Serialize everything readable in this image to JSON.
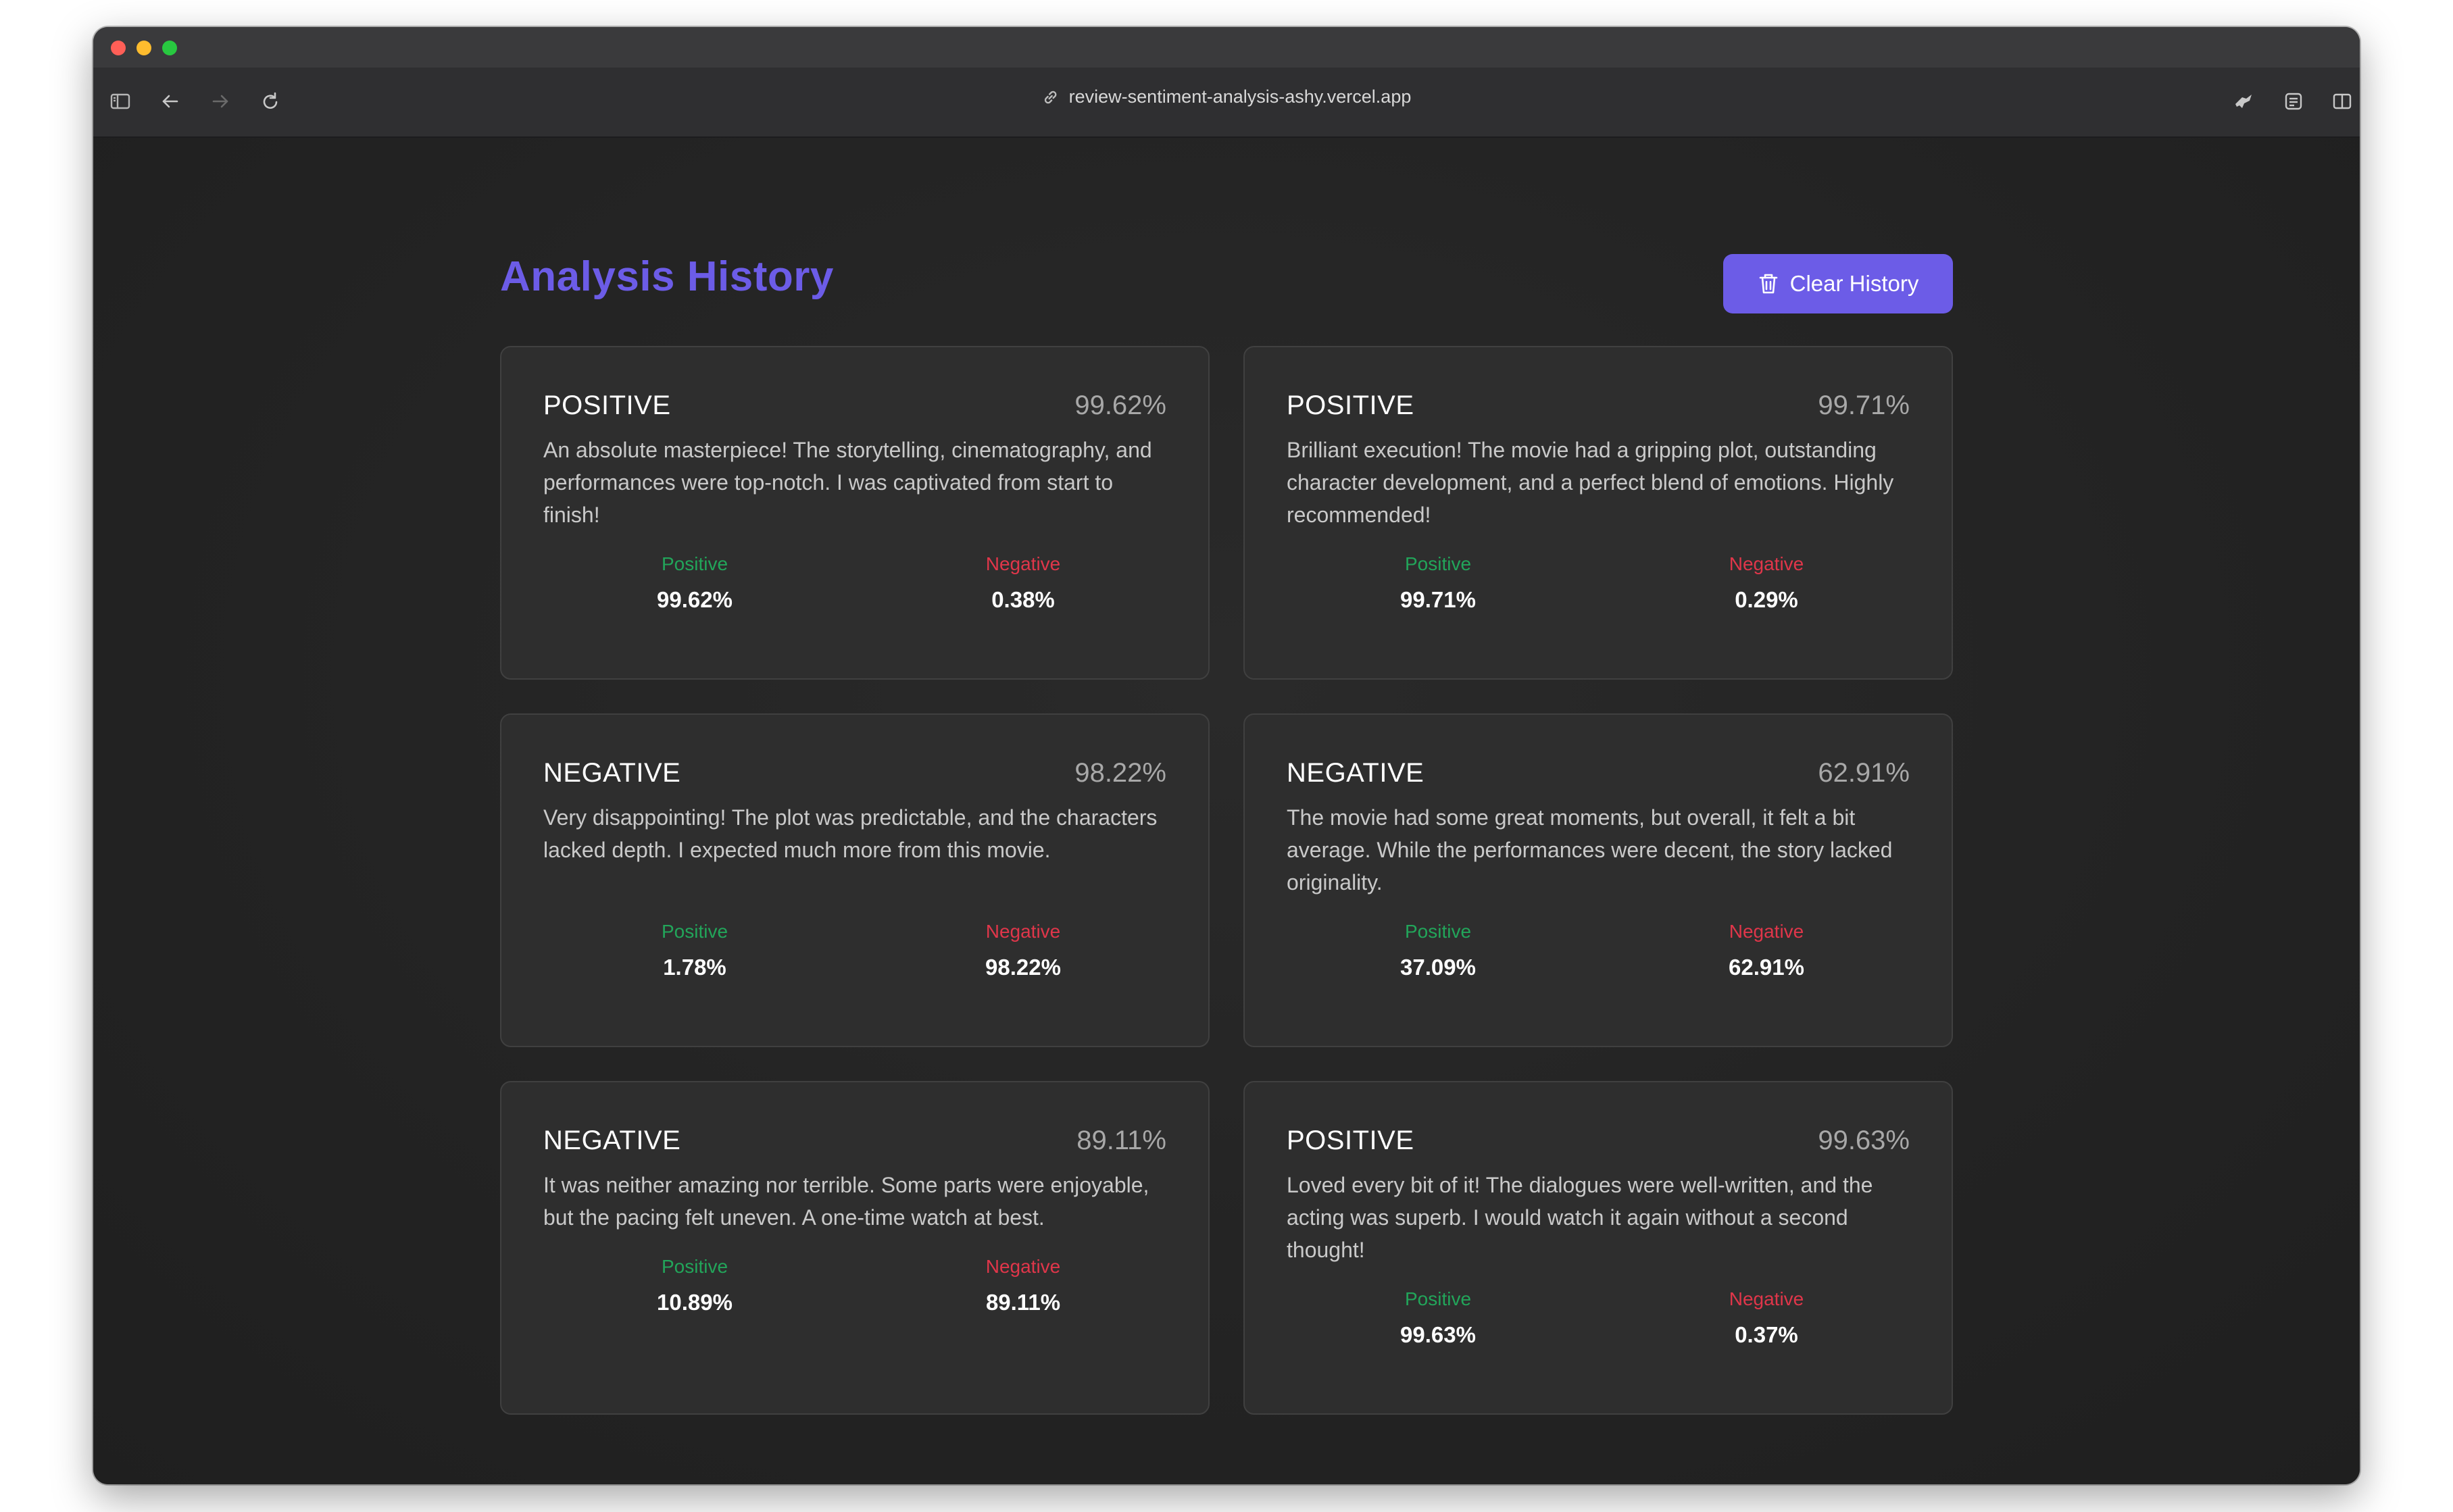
{
  "browser": {
    "url": "review-sentiment-analysis-ashy.vercel.app"
  },
  "header": {
    "title": "Analysis History",
    "clear_label": "Clear History"
  },
  "labels": {
    "positive": "Positive",
    "negative": "Negative"
  },
  "colors": {
    "accent": "#6c5ce7",
    "positive": "#22a55a",
    "negative": "#e0364a",
    "card_bg": "#2e2e2e",
    "page_bg": "#232323"
  },
  "cards": [
    {
      "label": "POSITIVE",
      "score": "99.62%",
      "text": "An absolute masterpiece! The storytelling, cinematography, and performances were top-notch. I was captivated from start to finish!",
      "positive": "99.62%",
      "negative": "0.38%"
    },
    {
      "label": "POSITIVE",
      "score": "99.71%",
      "text": "Brilliant execution! The movie had a gripping plot, outstanding character development, and a perfect blend of emotions. Highly recommended!",
      "positive": "99.71%",
      "negative": "0.29%"
    },
    {
      "label": "NEGATIVE",
      "score": "98.22%",
      "text": "Very disappointing! The plot was predictable, and the characters lacked depth. I expected much more from this movie.",
      "positive": "1.78%",
      "negative": "98.22%"
    },
    {
      "label": "NEGATIVE",
      "score": "62.91%",
      "text": "The movie had some great moments, but overall, it felt a bit average. While the performances were decent, the story lacked originality.",
      "positive": "37.09%",
      "negative": "62.91%"
    },
    {
      "label": "NEGATIVE",
      "score": "89.11%",
      "text": "It was neither amazing nor terrible. Some parts were enjoyable, but the pacing felt uneven. A one-time watch at best.",
      "positive": "10.89%",
      "negative": "89.11%"
    },
    {
      "label": "POSITIVE",
      "score": "99.63%",
      "text": "Loved every bit of it! The dialogues were well-written, and the acting was superb. I would watch it again without a second thought!",
      "positive": "99.63%",
      "negative": "0.37%"
    }
  ]
}
